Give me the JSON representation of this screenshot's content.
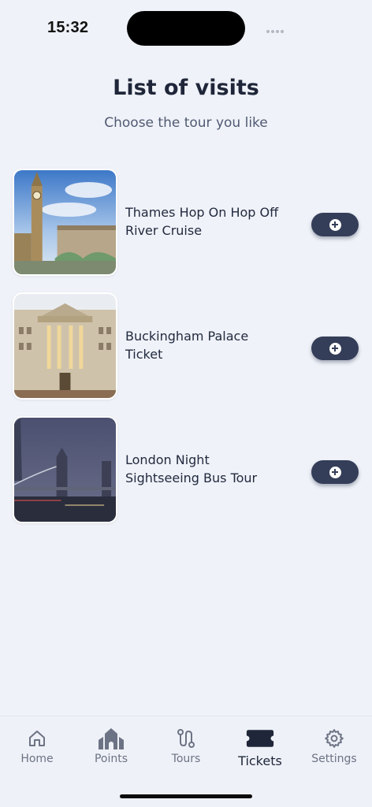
{
  "status_bar": {
    "time": "15:32"
  },
  "header": {
    "title": "List of visits",
    "subtitle": "Choose the tour you like"
  },
  "visits": [
    {
      "name": "Thames Hop On Hop Off River Cruise",
      "image": "big-ben-westminster-photo",
      "action_icon": "plus-circle-icon"
    },
    {
      "name": "Buckingham Palace Ticket",
      "image": "buckingham-palace-photo",
      "action_icon": "plus-circle-icon"
    },
    {
      "name": "London Night Sightseeing Bus Tour",
      "image": "tower-bridge-night-photo",
      "action_icon": "plus-circle-icon"
    }
  ],
  "tab_bar": {
    "active": "Tickets",
    "items": [
      {
        "label": "Home",
        "icon": "home-icon"
      },
      {
        "label": "Points",
        "icon": "church-icon"
      },
      {
        "label": "Tours",
        "icon": "route-icon"
      },
      {
        "label": "Tickets",
        "icon": "ticket-icon"
      },
      {
        "label": "Settings",
        "icon": "gear-icon"
      }
    ]
  },
  "colors": {
    "background": "#eff2f8",
    "accent": "#343e58",
    "text": "#222a3f",
    "muted": "#6c7384"
  }
}
